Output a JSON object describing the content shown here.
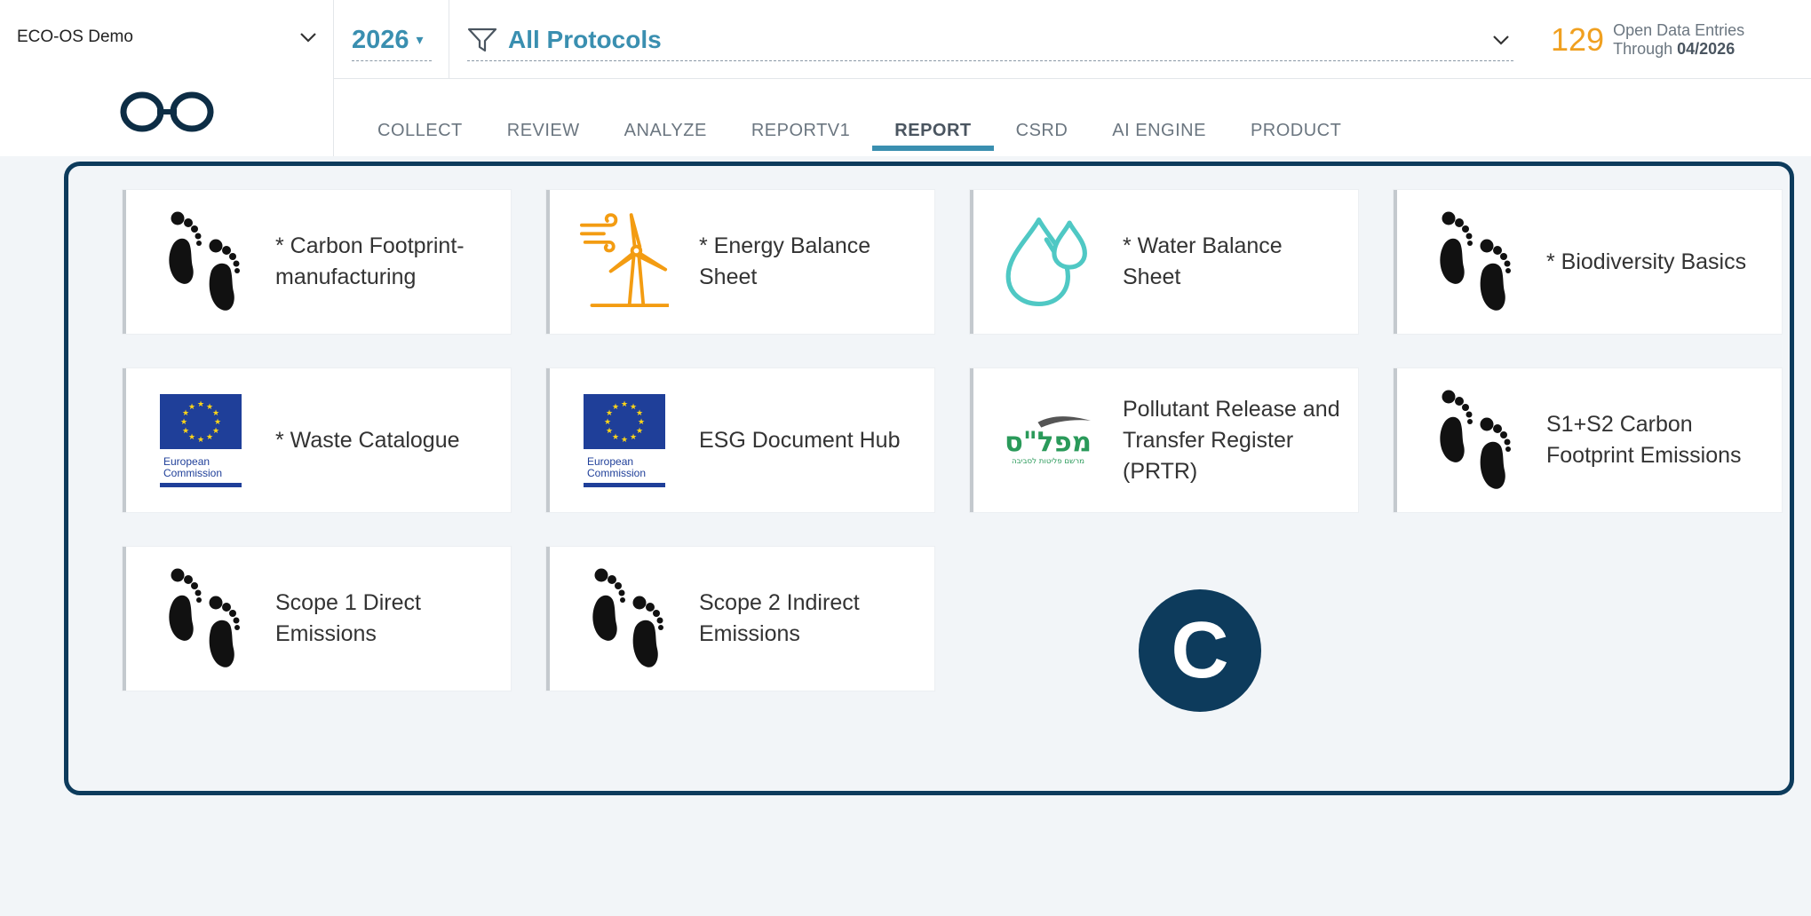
{
  "header": {
    "org_name": "ECO-OS Demo",
    "year": "2026",
    "protocol_filter": "All Protocols",
    "open_entries_count": "129",
    "open_entries_label": "Open Data Entries",
    "through_label": "Through",
    "through_date": "04/2026"
  },
  "tabs": [
    {
      "label": "COLLECT"
    },
    {
      "label": "REVIEW"
    },
    {
      "label": "ANALYZE"
    },
    {
      "label": "REPORTV1"
    },
    {
      "label": "REPORT",
      "active": true
    },
    {
      "label": "CSRD"
    },
    {
      "label": "AI ENGINE"
    },
    {
      "label": "PRODUCT"
    }
  ],
  "cards": [
    {
      "label": "* Carbon Footprint-manufacturing",
      "icon": "footprint-icon"
    },
    {
      "label": "* Energy Balance Sheet",
      "icon": "wind-turbine-icon"
    },
    {
      "label": "* Water Balance Sheet",
      "icon": "water-drops-icon"
    },
    {
      "label": "* Biodiversity Basics",
      "icon": "footprint-icon"
    },
    {
      "label": "* Waste Catalogue",
      "icon": "european-commission-logo"
    },
    {
      "label": "ESG Document Hub",
      "icon": "european-commission-logo"
    },
    {
      "label": "Pollutant Release and Transfer Register (PRTR)",
      "icon": "prtr-logo"
    },
    {
      "label": "S1+S2 Carbon Footprint Emissions",
      "icon": "footprint-icon"
    },
    {
      "label": "Scope 1 Direct Emissions",
      "icon": "footprint-icon"
    },
    {
      "label": "Scope 2 Indirect Emissions",
      "icon": "footprint-icon"
    }
  ],
  "logo_text": {
    "ec_line1": "European",
    "ec_line2": "Commission",
    "prtr_main": "מפל\"ס",
    "prtr_sub": "מרשם פליטות לסביבה"
  },
  "badge": "C",
  "colors": {
    "accent": "#3a8fb0",
    "count": "#f0a020",
    "panel_border": "#0d3b5c",
    "energy_icon": "#f39c12",
    "water_icon": "#4fc8c4",
    "eu_blue": "#1f3f99",
    "eu_star": "#ffd617"
  }
}
